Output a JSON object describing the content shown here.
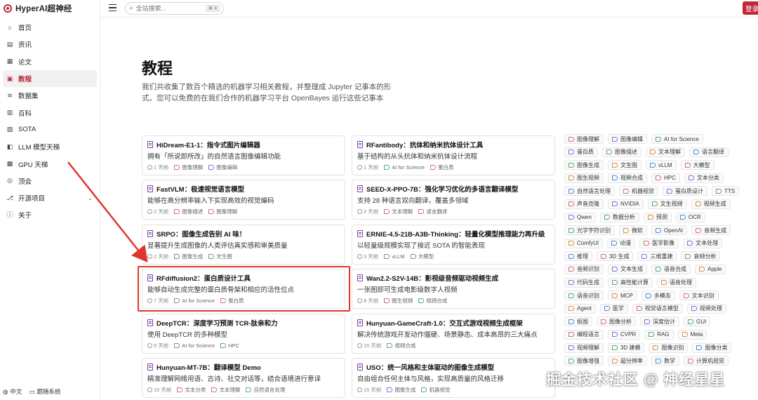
{
  "app": {
    "brand": "HyperAI超神经"
  },
  "colors": {
    "brand": "#c0283a",
    "highlight": "#e0362c",
    "icon_purple": "#7b3fa3"
  },
  "sidebar": {
    "items": [
      {
        "label": "首页",
        "icon": "home-icon"
      },
      {
        "label": "资讯",
        "icon": "news-icon"
      },
      {
        "label": "论文",
        "icon": "paper-icon"
      },
      {
        "label": "教程",
        "icon": "tutorial-icon",
        "active": true
      },
      {
        "label": "数据集",
        "icon": "database-icon"
      },
      {
        "label": "百科",
        "icon": "wiki-icon"
      },
      {
        "label": "SOTA",
        "icon": "chart-icon"
      },
      {
        "label": "LLM 模型天梯",
        "icon": "llm-icon"
      },
      {
        "label": "GPU 天梯",
        "icon": "gpu-icon"
      },
      {
        "label": "顶会",
        "icon": "conference-icon"
      },
      {
        "label": "开源项目",
        "icon": "opensource-icon",
        "expandable": true
      },
      {
        "label": "关于",
        "icon": "info-icon"
      }
    ],
    "footer": {
      "language": "中文",
      "theme": "跟随系统"
    }
  },
  "topbar": {
    "search_placeholder": "全站搜索...",
    "search_shortcut": "⌘ K",
    "login_label": "登录"
  },
  "header": {
    "title": "教程",
    "description": "我们共收集了数百个精选的机器学习相关教程，并整理成 Jupyter 记事本的形式。您可以免费的在我们合作的机器学习平台 OpenBayes 运行这些记事本"
  },
  "tutorials": [
    {
      "title": "HiDream-E1-1：指令式图片编辑器",
      "desc": "拥有「所说即所改」的自然语言图像编辑功能",
      "time": "1 天前",
      "tags": [
        "图像理解",
        "图像编辑"
      ]
    },
    {
      "title": "RFantibody：抗体和纳米抗体设计工具",
      "desc": "基于结构的从头抗体和纳米抗体设计流程",
      "time": "1 天前",
      "tags": [
        "AI for Science",
        "蛋白质"
      ]
    },
    {
      "title": "FastVLM：极速视觉语言模型",
      "desc": "能够在高分辨率输入下实现高效的视觉编码",
      "time": "2 天前",
      "tags": [
        "图像描述",
        "图像理解"
      ]
    },
    {
      "title": "SEED-X-PPO-7B：强化学习优化的多语言翻译模型",
      "desc": "支持 28 种语言双向翻译，覆盖多领域",
      "time": "2 天前",
      "tags": [
        "文本理解",
        "语言翻译"
      ]
    },
    {
      "title": "SRPO：图像生成告别 AI 味！",
      "desc": "显著提升生成图像的人类评估真实感和审美质量",
      "time": "2 天前",
      "tags": [
        "图像生成",
        "文生图"
      ]
    },
    {
      "title": "ERNIE-4.5-21B-A3B-Thinking：轻量化模型推理能力再升级",
      "desc": "以轻量级规模实现了接近 SOTA 的智能表现",
      "time": "3 天前",
      "tags": [
        "vLLM",
        "大模型"
      ]
    },
    {
      "title": "RFdiffusion2：蛋白质设计工具",
      "desc": "能够自动生成完整的蛋白质骨架和相应的活性位点",
      "time": "7 天前",
      "tags": [
        "AI for Science",
        "蛋白质"
      ]
    },
    {
      "title": "Wan2.2-S2V-14B：影视级音频驱动视频生成",
      "desc": "一张图即可生成电影级数字人视频",
      "time": "8 天前",
      "tags": [
        "图生视频",
        "视频合成"
      ]
    },
    {
      "title": "DeepTCR：深度学习预测 TCR-肽亲和力",
      "desc": "使用 DeepTCR 的多种模型",
      "time": "9 天前",
      "tags": [
        "AI for Science",
        "HPC"
      ]
    },
    {
      "title": "Hunyuan-GameCraft-1.0：交互式游戏视频生成框架",
      "desc": "解决传统游戏开发动作僵硬、场景静态、成本高昂的三大痛点",
      "time": "15 天前",
      "tags": [
        "视频合成"
      ]
    },
    {
      "title": "Hunyuan-MT-7B：翻译模型 Demo",
      "desc": "精准理解网络用语、古诗、社交对话等，结合语境进行意译",
      "time": "15 天前",
      "tags": [
        "文本分类",
        "文本理解",
        "自然语言处理"
      ]
    },
    {
      "title": "USO：统一风格和主体驱动的图像生成模型",
      "desc": "自由组合任何主体与风格，实现高质量的风格迁移",
      "time": "15 天前",
      "tags": [
        "图像生成",
        "机器视觉"
      ]
    }
  ],
  "tag_cloud": [
    [
      "图像理解",
      "图像编辑",
      "AI for Science"
    ],
    [
      "蛋白质",
      "图像描述",
      "文本理解",
      "语言翻译"
    ],
    [
      "图像生成",
      "文生图",
      "vLLM",
      "大模型"
    ],
    [
      "图生视频",
      "视频合成",
      "HPC",
      "文本分类"
    ],
    [
      "自然语言处理",
      "机器视觉",
      "蛋白质设计",
      "TTS"
    ],
    [
      "声音克隆",
      "NVIDIA",
      "文生视频",
      "视频生成"
    ],
    [
      "Qwen",
      "数据分析",
      "预测",
      "OCR"
    ],
    [
      "光学字符识别",
      "微软",
      "OpenAI",
      "音频生成"
    ],
    [
      "ComfyUI",
      "动漫",
      "医学影像",
      "文本处理"
    ],
    [
      "推理",
      "3D 生成",
      "三维重建",
      "音频分析"
    ],
    [
      "音频识别",
      "文本生成",
      "语音合成",
      "Apple"
    ],
    [
      "代码生成",
      "高性能计算",
      "语音处理"
    ],
    [
      "语音识别",
      "MCP",
      "多模态",
      "文本识别"
    ],
    [
      "Agent",
      "医学",
      "视觉语言模型",
      "视频处理"
    ],
    [
      "抠图",
      "图像分析",
      "深度估计",
      "GUI"
    ],
    [
      "编程语言",
      "CVPR",
      "RAG",
      "Meta"
    ],
    [
      "视频理解",
      "3D 建模",
      "图像识别",
      "图像分类"
    ],
    [
      "图像增强",
      "超分辨率",
      "数学",
      "计算机视觉"
    ]
  ],
  "watermark": "掘金技术社区 @ 神经星星"
}
